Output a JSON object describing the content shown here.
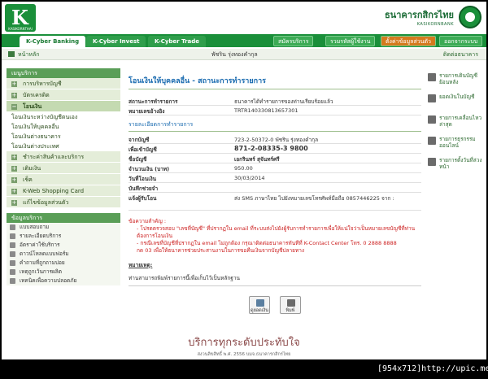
{
  "header": {
    "logo_letter": "K",
    "logo_text": "KASIKORNTHAI",
    "bank_name_th": "ธนาคารกสิกรไทย",
    "bank_name_en": "KASIKORNBANK"
  },
  "topnav": {
    "tabs": [
      "K-Cyber Banking",
      "K-Cyber Invest",
      "K-Cyber Trade"
    ],
    "right": [
      "สมัครบริการ",
      "รวมรหัสผู้ใช้งาน",
      "ตั้งค่าข้อมูลส่วนตัว",
      "ออกจากระบบ"
    ]
  },
  "crumb": {
    "home": "หน้าหลัก",
    "user": "พัชริน รุ่งทองคำกุล",
    "contact": "ติดต่อธนาคาร"
  },
  "menu": {
    "header": "เมนูบริการ",
    "items": [
      "การบริหารบัญชี",
      "บัตรเครดิต",
      "โอนเงิน"
    ],
    "subitems": [
      "โอนเงินระหว่างบัญชีตนเอง",
      "โอนเงินให้บุคคลอื่น",
      "โอนเงินต่างธนาคาร",
      "โอนเงินต่างประเทศ"
    ],
    "items2": [
      "ชำระค่าสินค้าและบริการ",
      "เติมเงิน",
      "เช็ค",
      "K-Web Shopping Card",
      "แก้ไขข้อมูลส่วนตัว"
    ],
    "tools_header": "ข้อมูลบริการ",
    "tools": [
      "แบบสอบถาม",
      "รายละเอียดบริการ",
      "อัตราค่าใช้บริการ",
      "ดาวน์โหลดแบบฟอร์ม",
      "คำถามที่ถูกถามบ่อย",
      "เหตุถูกเว้นการผลิต",
      "เทคนิคเพื่อความปลอดภัย"
    ]
  },
  "main": {
    "title": "โอนเงินให้บุคคลอื่น - สถานะการทำรายการ",
    "status_label": "สถานะการทำรายการ",
    "status_value": "ธนาคารได้ทำรายการของท่านเรียบร้อยแล้ว",
    "ref_label": "หมายเลขอ้างอิง",
    "ref_value": "TRTR140330813657301",
    "detail_head": "รายละเอียดการทำรายการ",
    "from_label": "จากบัญชี",
    "from_value": "723-2-50372-0 พัชริน รุ่งทองคำกุล",
    "to_label": "เพื่อเข้าบัญชี",
    "to_value": "871-2-08335-3 9800",
    "name_label": "ชื่อบัญชี",
    "name_value": "เอกรินทร์ สุจันทร์ศรี",
    "amount_label": "จำนวนเงิน (บาท)",
    "amount_value": "950.00",
    "date_label": "วันที่โอนเงิน",
    "date_value": "30/03/2014",
    "memo_label": "บันทึกช่วยจำ",
    "memo_value": "",
    "sms_label": "แจ้งผู้รับโอน",
    "sms_value": "ส่ง SMS ภาษาไทย ไปยังหมายเลขโทรศัพท์มือถือ 0857446225 จาก :",
    "note_head": "ข้อความสำคัญ :",
    "notes": [
      "- โปรดตรวจสอบ \"เลขที่บัญชี\" ที่ปรากฏใน email ที่ระบบส่งไปยังผู้รับการทำรายการเพื่อให้แน่ใจว่าเป็นหมายเลขบัญชีที่ท่านต้องการโอนเงิน",
      "- กรณีเลขที่บัญชีที่ปรากฏใน email ไม่ถูกต้อง กรุณาติดต่อธนาคารทันทีที่ K-Contact Center โทร. 0 2888 8888",
      "กด 03 เพื่อให้ธนาคารช่วยประสานงานในการขอคืนเงินจากบัญชีปลายทาง"
    ],
    "remark_head": "หมายเหตุ:",
    "remark_text": "ท่านสามารถพิมพ์รายการนี้เพื่อเก็บไว้เป็นหลักฐาน",
    "btn_save": "ดูยอดเงิน",
    "btn_print": "พิมพ์"
  },
  "rightbar": [
    "รายการเดินบัญชีย้อนหลัง",
    "ยอดเงินในบัญชี",
    "รายการเคลื่อนไหวล่าสุด",
    "รายการธุรกรรมออนไลน์",
    "รายการตั้งวันที่ล่วงหน้า"
  ],
  "footer": {
    "slogan": "บริการทุกระดับประทับใจ",
    "copyright": "สงวนลิขสิทธิ์ พ.ศ. 2556 บมจ.ธนาคารกสิกรไทย"
  },
  "stamp": "[954x712]http://upic.me/"
}
